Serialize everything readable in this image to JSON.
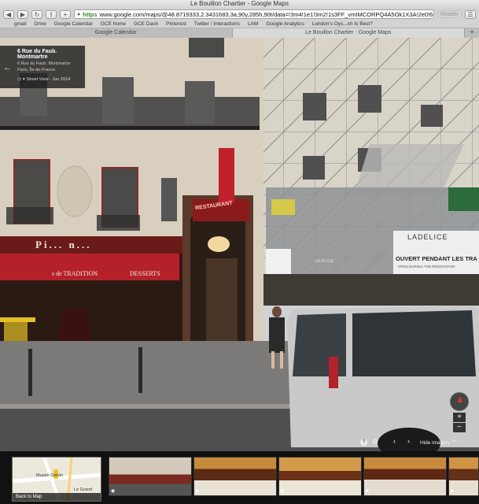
{
  "browser": {
    "window_title": "Le Bouillon Chartier - Google Maps",
    "url_scheme": "https",
    "url": "www.google.com/maps/@48.8719333,2.3431683,3a,90y,285h,90t/data=!3m4!1e1!3m2!1s3FF_vmIMCORPQ4A5Ok1X3A!2e0!6m1!1e1",
    "reader_label": "Reader",
    "bookmarks": [
      "gmail",
      "Drive",
      "Google Calendar",
      "GCE home",
      "GCE Dash",
      "Pinterest",
      "Twitter / Interactions",
      "LAM",
      "Google Analytics",
      "London's Oys...ch Is Best?"
    ],
    "tabs": [
      {
        "label": "Google Calendar",
        "active": false
      },
      {
        "label": "Le Bouillon Chartier - Google Maps",
        "active": true
      }
    ]
  },
  "address_card": {
    "title": "6 Rue du Faub. Montmartre",
    "line1": "6 Rue du Faub. Montmartre",
    "line2": "Paris, Île-de-France",
    "street_view_label": "Street View - Jun 2014"
  },
  "scene_text": {
    "cafe_sign": "Pi... n...",
    "awning_left": "s de TRADITION",
    "awning_right": "DESSERTS",
    "restaurant_sign": "RESTAURANT",
    "banner_brand": "LADELICE",
    "banner_main": "OUVERT PENDANT LES TRA",
    "banner_sub": "OPEN DURING THE RENOVATION",
    "banner_small": "LADELICE"
  },
  "controls": {
    "hide_imagery": "Hide imagery",
    "zoom_in": "+",
    "zoom_out": "−"
  },
  "filmstrip": {
    "back_to_map": "Back to Map",
    "map_labels": [
      "Musée Grévin",
      "Le Grand"
    ]
  },
  "colors": {
    "awning_red": "#b5212a",
    "neon_red": "#e02a2a",
    "van_silver": "#c9c9c9"
  }
}
